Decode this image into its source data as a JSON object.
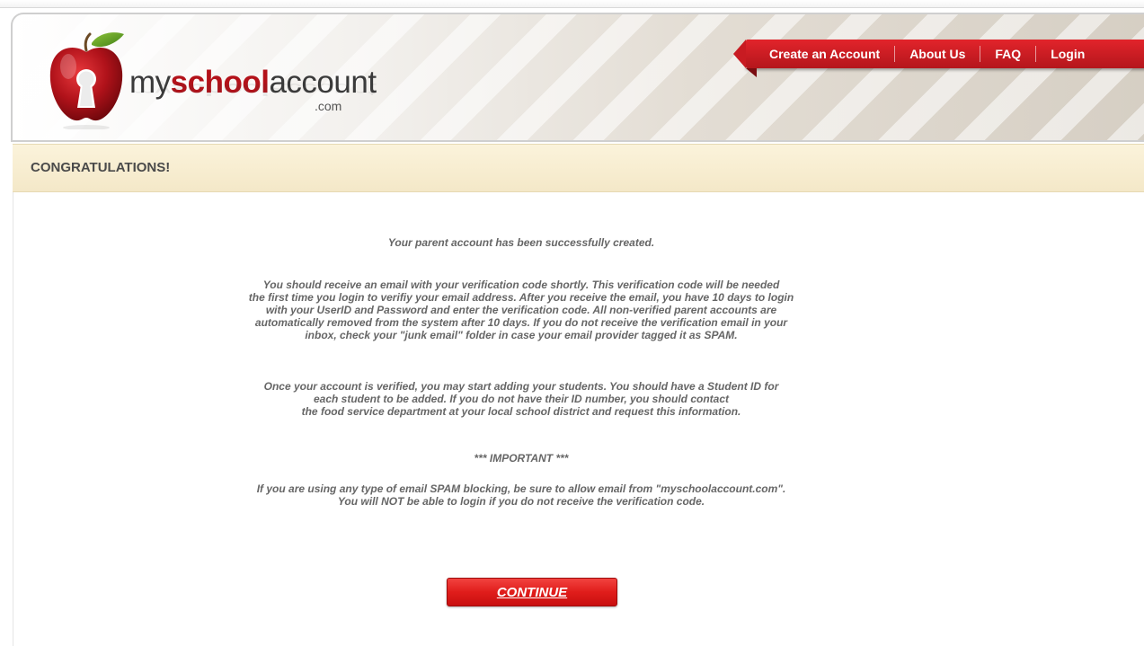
{
  "brand": {
    "prefix": "my",
    "bold": "school",
    "suffix": "account",
    "domain": ".com",
    "accent_color": "#b3121a"
  },
  "nav": {
    "items": [
      {
        "label": "Create an Account"
      },
      {
        "label": "About Us"
      },
      {
        "label": "FAQ"
      },
      {
        "label": "Login"
      }
    ],
    "ribbon_color": "#d21c22"
  },
  "title_bar": {
    "title": "CONGRATULATIONS!"
  },
  "content": {
    "success_line": "Your parent account has been successfully created.",
    "verification_lines": [
      "You should receive an email with your verification code shortly. This verification code will be needed",
      "the first time you login to verifiy your email address.  After you receive the email, you have 10 days to login",
      "with your UserID and Password and enter the verification code. All non-verified parent accounts are",
      "automatically removed from the system after 10 days. If you do not receive the verification email in your",
      "inbox, check your \"junk email\" folder in case your email provider tagged it as SPAM."
    ],
    "students_lines": [
      "Once your account is verified, you may start adding your students. You should have a Student ID for",
      "each student to be added. If you do not have their ID number, you should contact",
      "the food service department at your local school district and request this information."
    ],
    "important_heading": "*** IMPORTANT ***",
    "important_lines": [
      "If you are using any type of email SPAM blocking, be sure to allow email from \"myschoolaccount.com\".",
      "You will NOT be able to login if you do not receive the verification code."
    ],
    "continue_label": "CONTINUE"
  },
  "icons": {
    "logo": "apple-keyhole-icon"
  }
}
